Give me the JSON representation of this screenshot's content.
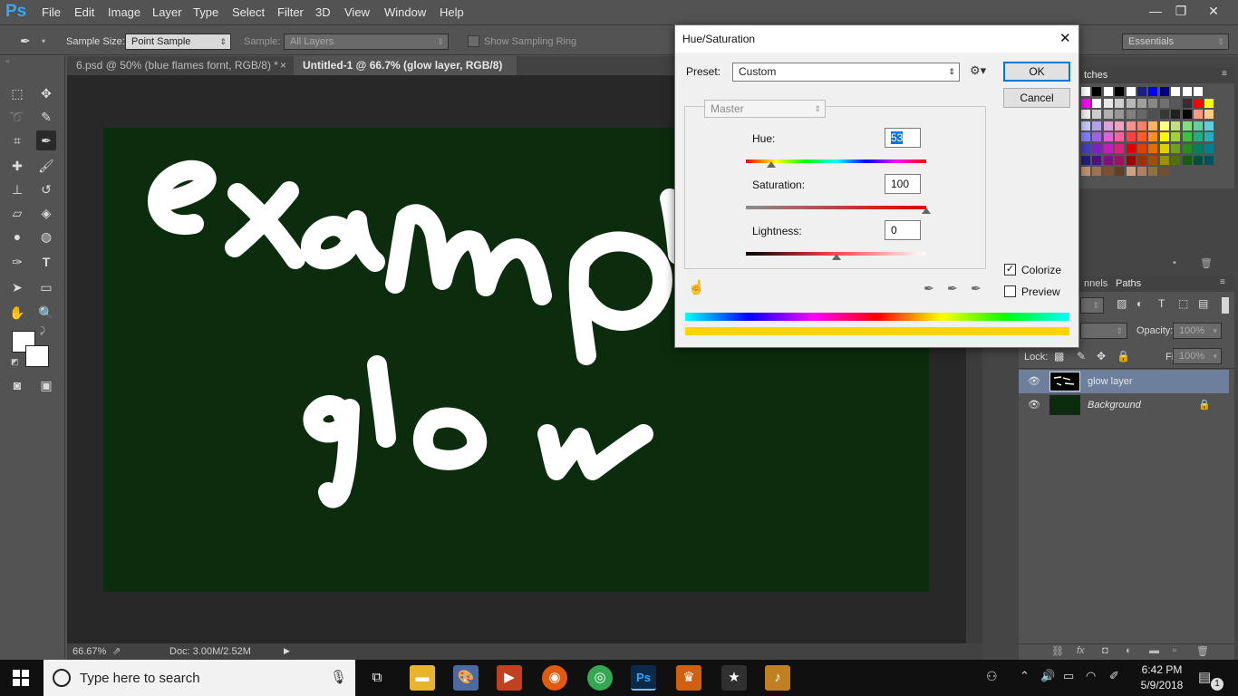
{
  "app": {
    "logo": "Ps"
  },
  "menu": [
    "File",
    "Edit",
    "Image",
    "Layer",
    "Type",
    "Select",
    "Filter",
    "3D",
    "View",
    "Window",
    "Help"
  ],
  "window_controls": {
    "minimize": "—",
    "restore": "❐",
    "close": "✕"
  },
  "options": {
    "sample_size_label": "Sample Size:",
    "sample_size_value": "Point Sample",
    "sample_label": "Sample:",
    "sample_value": "All Layers",
    "sampling_ring_label": "Show Sampling Ring",
    "workspace": "Essentials"
  },
  "tabs": [
    {
      "label": "6.psd @ 50% (blue flames fornt, RGB/8) *",
      "close": "×"
    },
    {
      "label": "Untitled-1 @ 66.7% (glow layer, RGB/8) *",
      "close": "×"
    }
  ],
  "status": {
    "zoom": "66.67%",
    "doc": "Doc: 3.00M/2.52M"
  },
  "panels": {
    "swatches_tab": "tches",
    "channels_tab": "nnels",
    "paths_tab": "Paths",
    "opacity_label": "Opacity:",
    "opacity_value": "100%",
    "lock_label": "Lock:",
    "fill_label": "Fill:",
    "fill_value": "100%"
  },
  "layers": [
    {
      "name": "glow layer",
      "selected": true
    },
    {
      "name": "Background",
      "selected": false
    }
  ],
  "swatch_colors": [
    [
      "#ffffff",
      "#000000",
      "#ffffff",
      "#000000",
      "#ffffff",
      "#1c1c8c",
      "#0000ff",
      "#00008b",
      "#ffffff",
      "#ffffff",
      "#ffffff"
    ],
    [
      "#ff00ff",
      "#ffffff",
      "#e8e8e8",
      "#d0d0d0",
      "#b8b8b8",
      "#a0a0a0",
      "#888888",
      "#707070",
      "#585858",
      "#303030",
      "#ff0000",
      "#ffff00"
    ],
    [
      "#f0f0f0",
      "#cccccc",
      "#b0b0b0",
      "#989898",
      "#808080",
      "#686868",
      "#505050",
      "#383838",
      "#202020",
      "#000000",
      "#ff9980",
      "#ffcc80"
    ],
    [
      "#c8c8ff",
      "#b0a0f0",
      "#e0a0e0",
      "#f0a0c0",
      "#ff9090",
      "#ff8060",
      "#ffb060",
      "#ffff80",
      "#c0e080",
      "#80e080",
      "#60d0a0",
      "#60d0e0"
    ],
    [
      "#8080ff",
      "#a060e0",
      "#e060e0",
      "#ff60a0",
      "#ff4040",
      "#ff6020",
      "#ff9020",
      "#ffff00",
      "#a0d040",
      "#40c040",
      "#20b080",
      "#20b0c0"
    ],
    [
      "#4040c0",
      "#8020c0",
      "#c020c0",
      "#e02080",
      "#e00000",
      "#e04000",
      "#e07000",
      "#e0d000",
      "#70a020",
      "#209020",
      "#008060",
      "#008090"
    ],
    [
      "#202080",
      "#501080",
      "#801080",
      "#a01060",
      "#a00000",
      "#a03000",
      "#a05000",
      "#a09000",
      "#507010",
      "#106010",
      "#005040",
      "#005060"
    ],
    [
      "#c09070",
      "#a07050",
      "#805030",
      "#604020",
      "#d0a080",
      "#b08060",
      "#907040",
      "#705030"
    ]
  ],
  "dialog": {
    "title": "Hue/Saturation",
    "close": "✕",
    "preset_label": "Preset:",
    "preset_value": "Custom",
    "ok": "OK",
    "cancel": "Cancel",
    "range": "Master",
    "hue_label": "Hue:",
    "hue_value": "53",
    "hue_slider": 0.143,
    "sat_label": "Saturation:",
    "sat_value": "100",
    "sat_slider": 1.0,
    "light_label": "Lightness:",
    "light_value": "0",
    "light_slider": 0.5,
    "colorize_label": "Colorize",
    "colorize_checked": true,
    "preview_label": "Preview",
    "preview_checked": false,
    "result_color": "#ffd400"
  },
  "canvas": {
    "bg_color": "#0b2d0d",
    "stroke_color": "#ffffff"
  },
  "taskbar": {
    "search_placeholder": "Type here to search",
    "time": "6:42 PM",
    "date": "5/9/2018",
    "notifications": "1"
  }
}
